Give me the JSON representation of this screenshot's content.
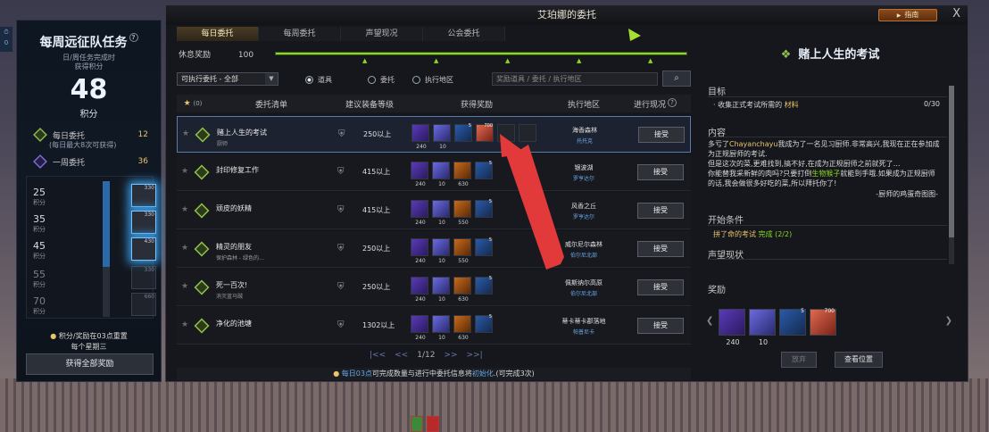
{
  "window_title": "艾珀娜的委托",
  "guide_label": "指南",
  "close_label": "X",
  "left_panel": {
    "title": "每周远征队任务",
    "sub1": "日/周任务完成时",
    "sub2": "获得积分",
    "points": "48",
    "points_unit": "积分",
    "daily_label": "每日委托",
    "daily_value": "12",
    "daily_note": "(每日最大8次可获得)",
    "weekly_label": "一周委托",
    "weekly_value": "36",
    "tiers": [
      {
        "value": "25",
        "unit": "积分",
        "badge": "330"
      },
      {
        "value": "35",
        "unit": "积分",
        "badge": "330"
      },
      {
        "value": "45",
        "unit": "积分",
        "badge": "430"
      },
      {
        "value": "55",
        "unit": "积分",
        "badge": "330"
      },
      {
        "value": "70",
        "unit": "积分",
        "badge": "660"
      }
    ],
    "reset_note_1": "积分/奖励在03点重置",
    "reset_note_2": "每个星期三",
    "claim_all": "获得全部奖励"
  },
  "tabs": [
    {
      "label": "每日委托",
      "active": true
    },
    {
      "label": "每周委托",
      "active": false
    },
    {
      "label": "声望现况",
      "active": false
    },
    {
      "label": "公会委托",
      "active": false
    }
  ],
  "rest": {
    "label": "休息奖励",
    "value": "100"
  },
  "rest_progress": 1.0,
  "filter": {
    "label": "可执行委托 - 全部",
    "arrow": "▼"
  },
  "radio": [
    {
      "label": "道具",
      "on": true
    },
    {
      "label": "委托",
      "on": false
    },
    {
      "label": "执行地区",
      "on": false
    }
  ],
  "search": {
    "placeholder": "奖励道具 / 委托 / 执行地区"
  },
  "table_header": {
    "fav_count": "(0)",
    "col_list": "委托清单",
    "col_level": "建议装备等级",
    "col_reward": "获得奖励",
    "col_region": "执行地区",
    "col_status": "进行现况"
  },
  "rows": [
    {
      "name": "赌上人生的考试",
      "sub": "厨师",
      "level": "250以上",
      "region": "海香森林",
      "region_sub": "托托克",
      "accept": "接受",
      "rewards": [
        {
          "cls": "p",
          "cnt": "240"
        },
        {
          "cls": "g",
          "cnt": "10"
        },
        {
          "cls": "b",
          "cnt": "",
          "sup": "5"
        },
        {
          "cls": "r",
          "cnt": "",
          "sup": "700"
        },
        {
          "cls": "",
          "cnt": ""
        },
        {
          "cls": "",
          "cnt": ""
        }
      ]
    },
    {
      "name": "封印修复工作",
      "sub": "",
      "level": "415以上",
      "region": "银波湖",
      "region_sub": "罗亨达尔",
      "accept": "接受",
      "rewards": [
        {
          "cls": "p",
          "cnt": "240"
        },
        {
          "cls": "g",
          "cnt": "10"
        },
        {
          "cls": "o",
          "cnt": "630"
        },
        {
          "cls": "b",
          "cnt": "",
          "sup": "5"
        }
      ]
    },
    {
      "name": "顽皮的妖精",
      "sub": "",
      "level": "415以上",
      "region": "风香之丘",
      "region_sub": "罗亨达尔",
      "accept": "接受",
      "rewards": [
        {
          "cls": "p",
          "cnt": "240"
        },
        {
          "cls": "g",
          "cnt": "10"
        },
        {
          "cls": "o",
          "cnt": "550"
        },
        {
          "cls": "b",
          "cnt": "",
          "sup": "5"
        }
      ]
    },
    {
      "name": "精灵的朋友",
      "sub": "保护森林 - 绿色的…",
      "level": "250以上",
      "region": "威尔尼尔森林",
      "region_sub": "伯尔尼北部",
      "accept": "接受",
      "rewards": [
        {
          "cls": "p",
          "cnt": "240"
        },
        {
          "cls": "g",
          "cnt": "10"
        },
        {
          "cls": "o",
          "cnt": "550"
        },
        {
          "cls": "b",
          "cnt": "",
          "sup": "5"
        }
      ]
    },
    {
      "name": "死一百次!",
      "sub": "消灭蓝马贼",
      "level": "250以上",
      "region": "佩斯纳尔高原",
      "region_sub": "伯尔尼北部",
      "accept": "接受",
      "rewards": [
        {
          "cls": "p",
          "cnt": "240"
        },
        {
          "cls": "g",
          "cnt": "10"
        },
        {
          "cls": "o",
          "cnt": "630"
        },
        {
          "cls": "b",
          "cnt": "",
          "sup": "5"
        }
      ]
    },
    {
      "name": "净化的池塘",
      "sub": "",
      "level": "1302以上",
      "region": "蒂卡蒂卡郡落地",
      "region_sub": "帕普尼卡",
      "accept": "接受",
      "rewards": [
        {
          "cls": "p",
          "cnt": "240"
        },
        {
          "cls": "g",
          "cnt": "10"
        },
        {
          "cls": "o",
          "cnt": "630"
        },
        {
          "cls": "b",
          "cnt": "",
          "sup": "5"
        }
      ]
    }
  ],
  "pager": {
    "first": "|<<",
    "prev": "<<",
    "page": "1/12",
    "next": ">>",
    "last": ">>|"
  },
  "bottom_note": {
    "a": "每日",
    "b": "03点",
    "c": "可完成数量与进行中委托信息将",
    "d": "初始化",
    "e": ".(可完成3次)"
  },
  "detail": {
    "title": "赌上人生的考试",
    "objective_label": "目标",
    "objective_text_a": "· 收集正式考试所需的",
    "objective_text_b": "材料",
    "objective_count": "0/30",
    "content_label": "内容",
    "body_1": "多亏了",
    "body_hl": "Chayanchayu",
    "body_2": "我成为了一名见习厨师.非常高兴,我现在正在参加成为正规厨师的考试.",
    "body_3": "但是这次的菜,更难找到,搞不好,在成为正规厨师之前就死了…",
    "body_4a": "你能替我采新鲜的肉吗?只要打倒",
    "body_4b": "生物猴子",
    "body_4c": "就能到手哦.如果成为正规厨师的话,我会做很多好吃的菜,所以拜托你了!",
    "sign": "-厨师的鸡蛋奇图图-",
    "start_label": "开始条件",
    "start_cond_a": "拼了命的考试",
    "start_cond_b": "完成 (2/2)",
    "rep_label": "声望现状",
    "reward_label": "奖励",
    "rewards": [
      {
        "cls": "p",
        "cnt": "240",
        "sup": ""
      },
      {
        "cls": "g",
        "cnt": "10",
        "sup": ""
      },
      {
        "cls": "b",
        "cnt": "",
        "sup": "5"
      },
      {
        "cls": "r",
        "cnt": "",
        "sup": "700"
      }
    ],
    "abandon": "放弃",
    "view_location": "查看位置"
  },
  "colors": {
    "accent_green": "#8ad820",
    "gold": "#e8c46a",
    "blue_link": "#6aa8e8",
    "annotation_red": "#e23a3a"
  }
}
